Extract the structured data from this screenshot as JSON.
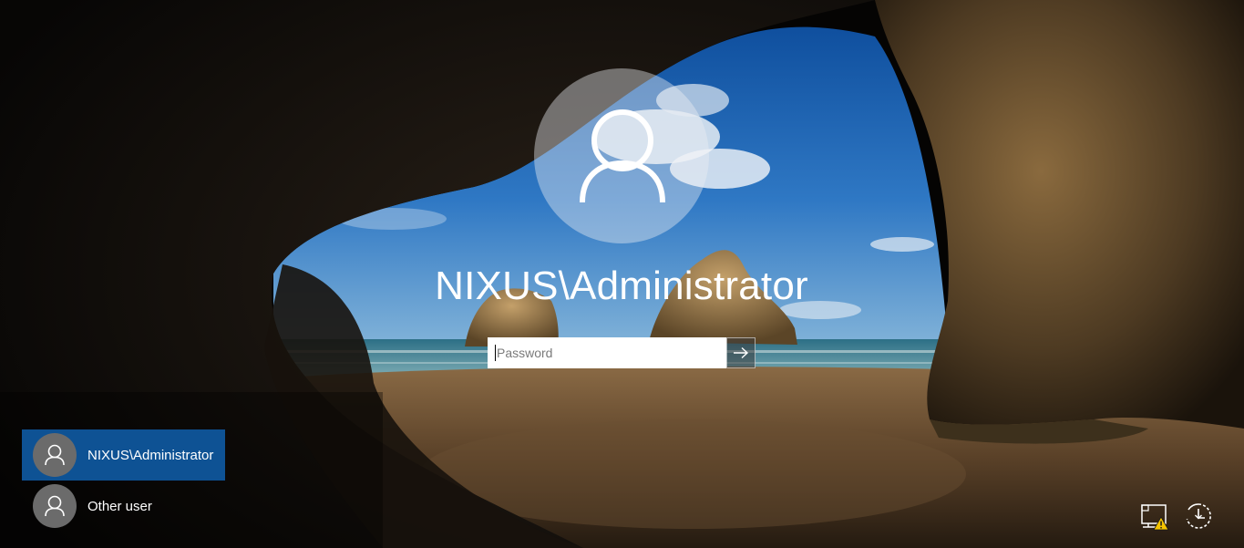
{
  "signin": {
    "username": "NIXUS\\Administrator",
    "password_placeholder": "Password",
    "avatar_icon": "user-silhouette-icon",
    "submit_icon": "arrow-right-icon"
  },
  "users": [
    {
      "name": "NIXUS\\Administrator",
      "selected": true,
      "icon": "user-silhouette-icon"
    },
    {
      "name": "Other user",
      "selected": false,
      "icon": "user-silhouette-icon"
    }
  ],
  "system_tray": {
    "network_icon": "network-warning-icon",
    "ease_of_access_icon": "ease-of-access-icon"
  },
  "colors": {
    "selected_user_bg": "#0e5294",
    "text": "#ffffff",
    "warning": "#f5c400"
  }
}
